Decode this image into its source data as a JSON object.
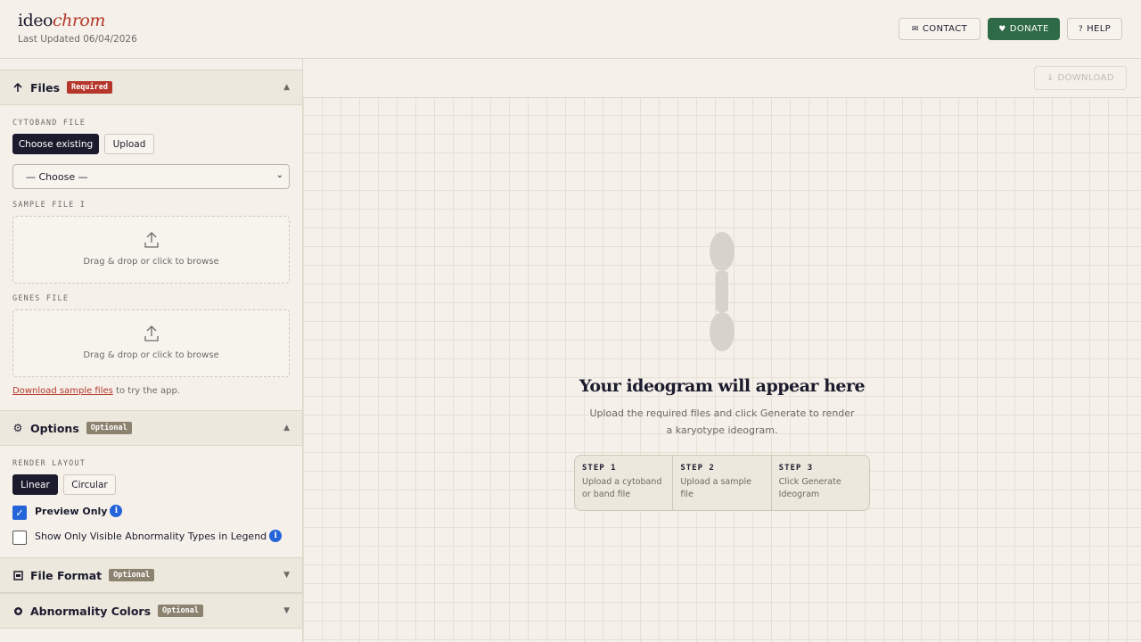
{
  "header": {
    "logo_part1": "ideo",
    "logo_part2": "chrom",
    "last_updated": "Last Updated 06/04/2026",
    "contact_label": "CONTACT",
    "donate_label": "DONATE",
    "help_label": "HELP"
  },
  "sidebar": {
    "files": {
      "title": "Files",
      "badge": "Required",
      "cytoband_label": "CYTOBAND FILE",
      "choose_existing": "Choose existing",
      "upload": "Upload",
      "select_value": "— Choose —",
      "sample_label": "SAMPLE FILE I",
      "sample_drop": "Drag & drop or click to browse",
      "genes_label": "GENES FILE",
      "genes_drop": "Drag & drop or click to browse",
      "sample_link": "Download sample files",
      "sample_link_suffix": " to try the app."
    },
    "options": {
      "title": "Options",
      "badge": "Optional",
      "render_label": "RENDER LAYOUT",
      "linear": "Linear",
      "circular": "Circular",
      "preview_only": "Preview Only",
      "preview_checked": true,
      "show_visible": "Show Only Visible Abnormality Types in Legend",
      "show_visible_checked": false
    },
    "file_format": {
      "title": "File Format",
      "badge": "Optional"
    },
    "abnormality_colors": {
      "title": "Abnormality Colors",
      "badge": "Optional"
    }
  },
  "main": {
    "download_label": "DOWNLOAD",
    "empty_title": "Your ideogram will appear here",
    "empty_sub": "Upload the required files and click Generate to render a karyotype ideogram.",
    "steps": [
      {
        "title": "STEP 1",
        "desc": "Upload a cytoband or band file"
      },
      {
        "title": "STEP 2",
        "desc": "Upload a sample file"
      },
      {
        "title": "STEP 3",
        "desc": "Click Generate Ideogram"
      }
    ]
  },
  "colors": {
    "accent_red": "#b5362a",
    "donate_green": "#2e6a47",
    "dark": "#1c1b2e",
    "checkbox_blue": "#2563d9"
  }
}
